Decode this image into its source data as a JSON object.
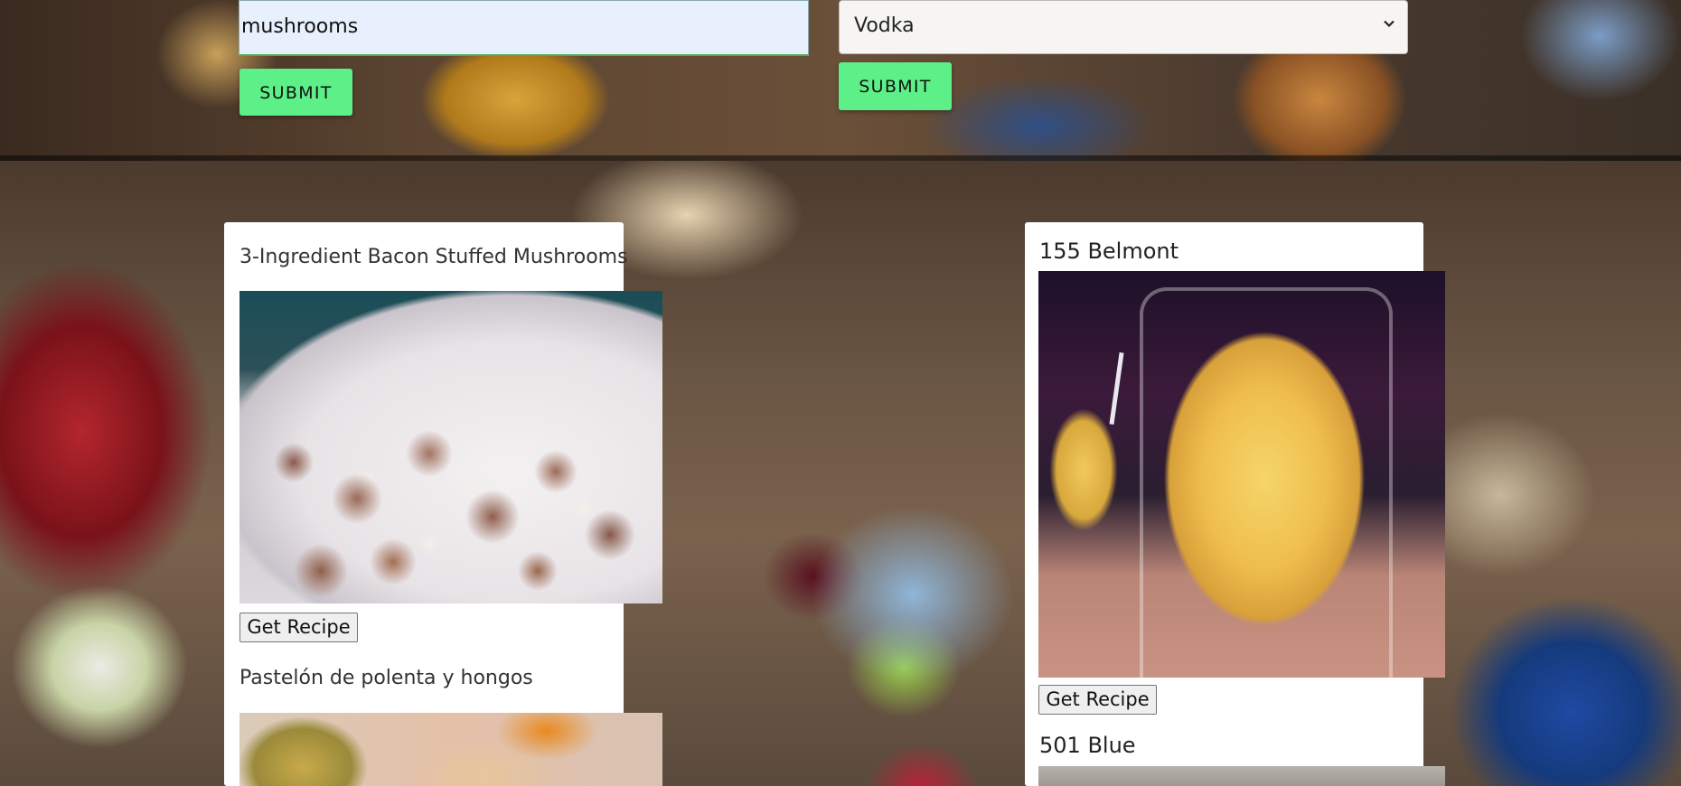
{
  "search": {
    "ingredient_value": "mushrooms",
    "submit_label": "SUBMIT"
  },
  "drinks_search": {
    "selected_spirit": "Vodka",
    "submit_label": "SUBMIT"
  },
  "recipes": [
    {
      "title": "3-Ingredient Bacon Stuffed Mushrooms",
      "button_label": "Get Recipe"
    },
    {
      "title": "Pastelón de polenta y hongos"
    }
  ],
  "drinks": [
    {
      "title": "155 Belmont",
      "button_label": "Get Recipe"
    },
    {
      "title": "501 Blue"
    }
  ],
  "colors": {
    "submit_button": "#5ef088",
    "input_autofill": "#e8f0fe"
  }
}
